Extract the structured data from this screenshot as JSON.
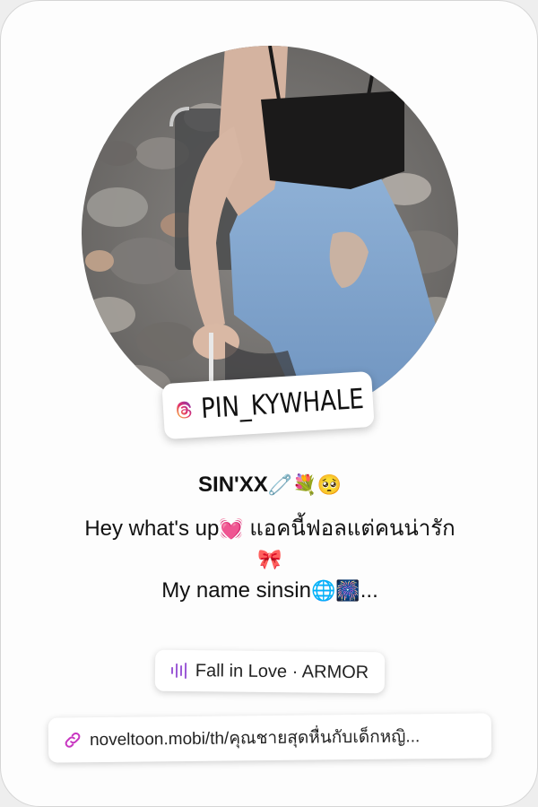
{
  "profile": {
    "username": "PIN_KYWHALE",
    "avatar_alt": "profile photo",
    "name": "SIN'XX",
    "name_emoji": "🧷💐🥺"
  },
  "bio": {
    "line1": "Hey what's up",
    "line1_emoji": "💓",
    "line1_thai": " แอคนี้ฟอลแต่คนน่ารัก",
    "line2_emoji": "🎀",
    "line3": "My name sinsin",
    "line3_emoji": "🌐🎆",
    "line3_tail": "..."
  },
  "music": {
    "icon": "audio-wave-icon",
    "label": "Fall in Love · ARMOR",
    "accent": "#9b59d6"
  },
  "link": {
    "icon": "link-icon",
    "url": "noveltoon.mobi/th/คุณชายสุดหื่นกับเด็กหญิ...",
    "accent": "#c837c1"
  },
  "colors": {
    "card_bg": "#fdfdfd",
    "threads_gradient": [
      "#f9c23c",
      "#e1306c",
      "#833ab4"
    ]
  }
}
